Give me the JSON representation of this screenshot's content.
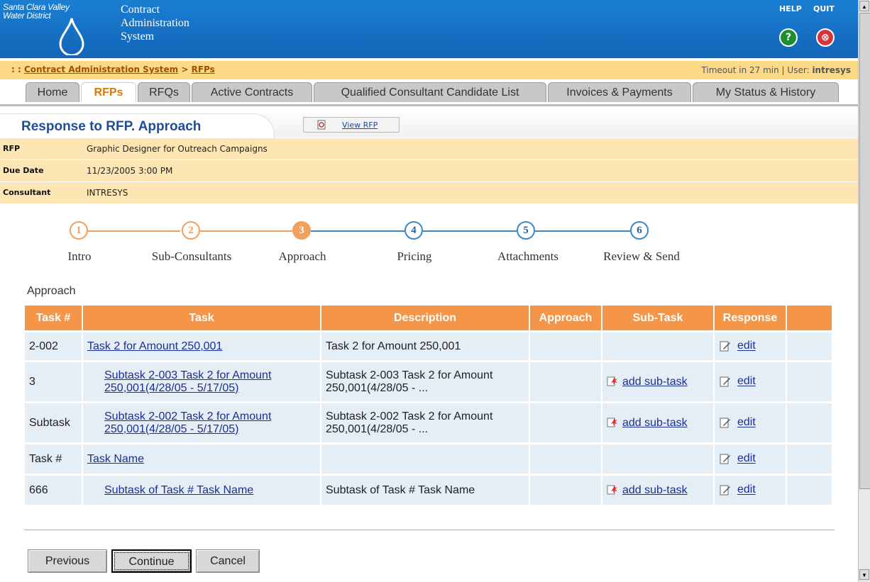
{
  "header": {
    "org_line1": "Santa Clara Valley",
    "org_line2": "Water District",
    "app_title_1": "Contract",
    "app_title_2": "Administration",
    "app_title_3": "System",
    "help_label": "HELP",
    "quit_label": "QUIT"
  },
  "breadcrumb": {
    "prefix": ": : ",
    "root": "Contract Administration System",
    "sep": " > ",
    "current": "RFPs",
    "timeout": "Timeout in 27 min",
    "divider": "|",
    "user_label": "User:",
    "user": "intresys"
  },
  "nav": {
    "tabs": [
      "Home",
      "RFPs",
      "RFQs",
      "Active Contracts",
      "Qualified Consultant Candidate List",
      "Invoices & Payments",
      "My Status & History"
    ],
    "active": "RFPs"
  },
  "page": {
    "title": "Response to RFP. Approach",
    "view_rfp": "View RFP"
  },
  "info": {
    "rfp_label": "RFP",
    "rfp_value": "Graphic Designer for Outreach Campaigns",
    "due_label": "Due Date",
    "due_value": "11/23/2005 3:00 PM",
    "consultant_label": "Consultant",
    "consultant_value": "INTRESYS"
  },
  "steps": [
    {
      "num": "1",
      "label": "Intro",
      "state": "done"
    },
    {
      "num": "2",
      "label": "Sub-Consultants",
      "state": "done"
    },
    {
      "num": "3",
      "label": "Approach",
      "state": "current"
    },
    {
      "num": "4",
      "label": "Pricing",
      "state": "todo"
    },
    {
      "num": "5",
      "label": "Attachments",
      "state": "todo"
    },
    {
      "num": "6",
      "label": "Review & Send",
      "state": "todo"
    }
  ],
  "section_title": "Approach",
  "table": {
    "headers": [
      "Task #",
      "Task",
      "Description",
      "Approach",
      "Sub-Task",
      "Response",
      ""
    ],
    "rows": [
      {
        "num": "2-002",
        "task1": "Task 2 for Amount 250,001",
        "task2": "",
        "desc1": "Task 2 for Amount 250,001",
        "desc2": "",
        "sub": "",
        "response": "edit"
      },
      {
        "num": "3",
        "task1": "Subtask 2-003 Task 2 for Amount",
        "task2": "250,001(4/28/05 - 5/17/05)",
        "desc1": "Subtask 2-003 Task 2 for Amount",
        "desc2": "250,001(4/28/05 - ...",
        "sub": "add sub-task",
        "response": "edit"
      },
      {
        "num": "Subtask",
        "task1": "Subtask 2-002 Task 2 for Amount",
        "task2": "250,001(4/28/05 - 5/17/05)",
        "desc1": "Subtask 2-002 Task 2 for Amount",
        "desc2": "250,001(4/28/05 - ...",
        "sub": "add sub-task",
        "response": "edit"
      },
      {
        "num": "Task #",
        "task1": "Task Name",
        "task2": "",
        "desc1": "",
        "desc2": "",
        "sub": "",
        "response": "edit"
      },
      {
        "num": "666",
        "task1": "Subtask of Task # Task Name",
        "task2": "",
        "desc1": "Subtask of Task # Task Name",
        "desc2": "",
        "sub": "add sub-task",
        "response": "edit"
      }
    ]
  },
  "buttons": {
    "previous": "Previous",
    "continue": "Continue",
    "cancel": "Cancel"
  },
  "colors": {
    "header_blue": "#1672c7",
    "accent_orange": "#f59547",
    "info_bg": "#fde6b4",
    "title_blue": "#1f4e98",
    "step_done": "#f2a05e",
    "step_todo": "#3d87c8"
  }
}
